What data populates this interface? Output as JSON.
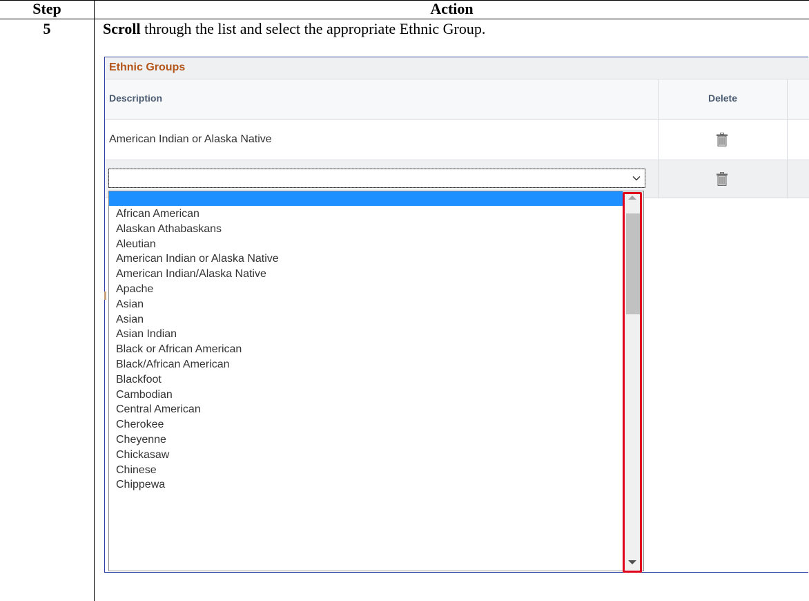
{
  "table": {
    "header_step": "Step",
    "header_action": "Action",
    "step_number": "5",
    "instruction_bold": "Scroll",
    "instruction_rest": " through the list and select the appropriate Ethnic Group."
  },
  "grid": {
    "title": "Ethnic Groups",
    "column_description": "Description",
    "column_delete": "Delete",
    "row1_value": "American Indian or Alaska Native",
    "row2_selected": ""
  },
  "dropdown": {
    "selected_option": "",
    "options": [
      "African American",
      "Alaskan Athabaskans",
      "Aleutian",
      "American Indian or Alaska Native",
      "American Indian/Alaska Native",
      "Apache",
      "Asian",
      "Asian",
      "Asian Indian",
      "Black or African American",
      "Black/African American",
      "Blackfoot",
      "Cambodian",
      "Central American",
      "Cherokee",
      "Cheyenne",
      "Chickasaw",
      "Chinese",
      "Chippewa"
    ]
  },
  "colors": {
    "title_accent": "#b4561a",
    "selection_blue": "#1e90ff",
    "highlight_red": "#e0001b"
  },
  "icons": {
    "delete": "trash-icon",
    "chevron": "chevron-down-icon"
  }
}
